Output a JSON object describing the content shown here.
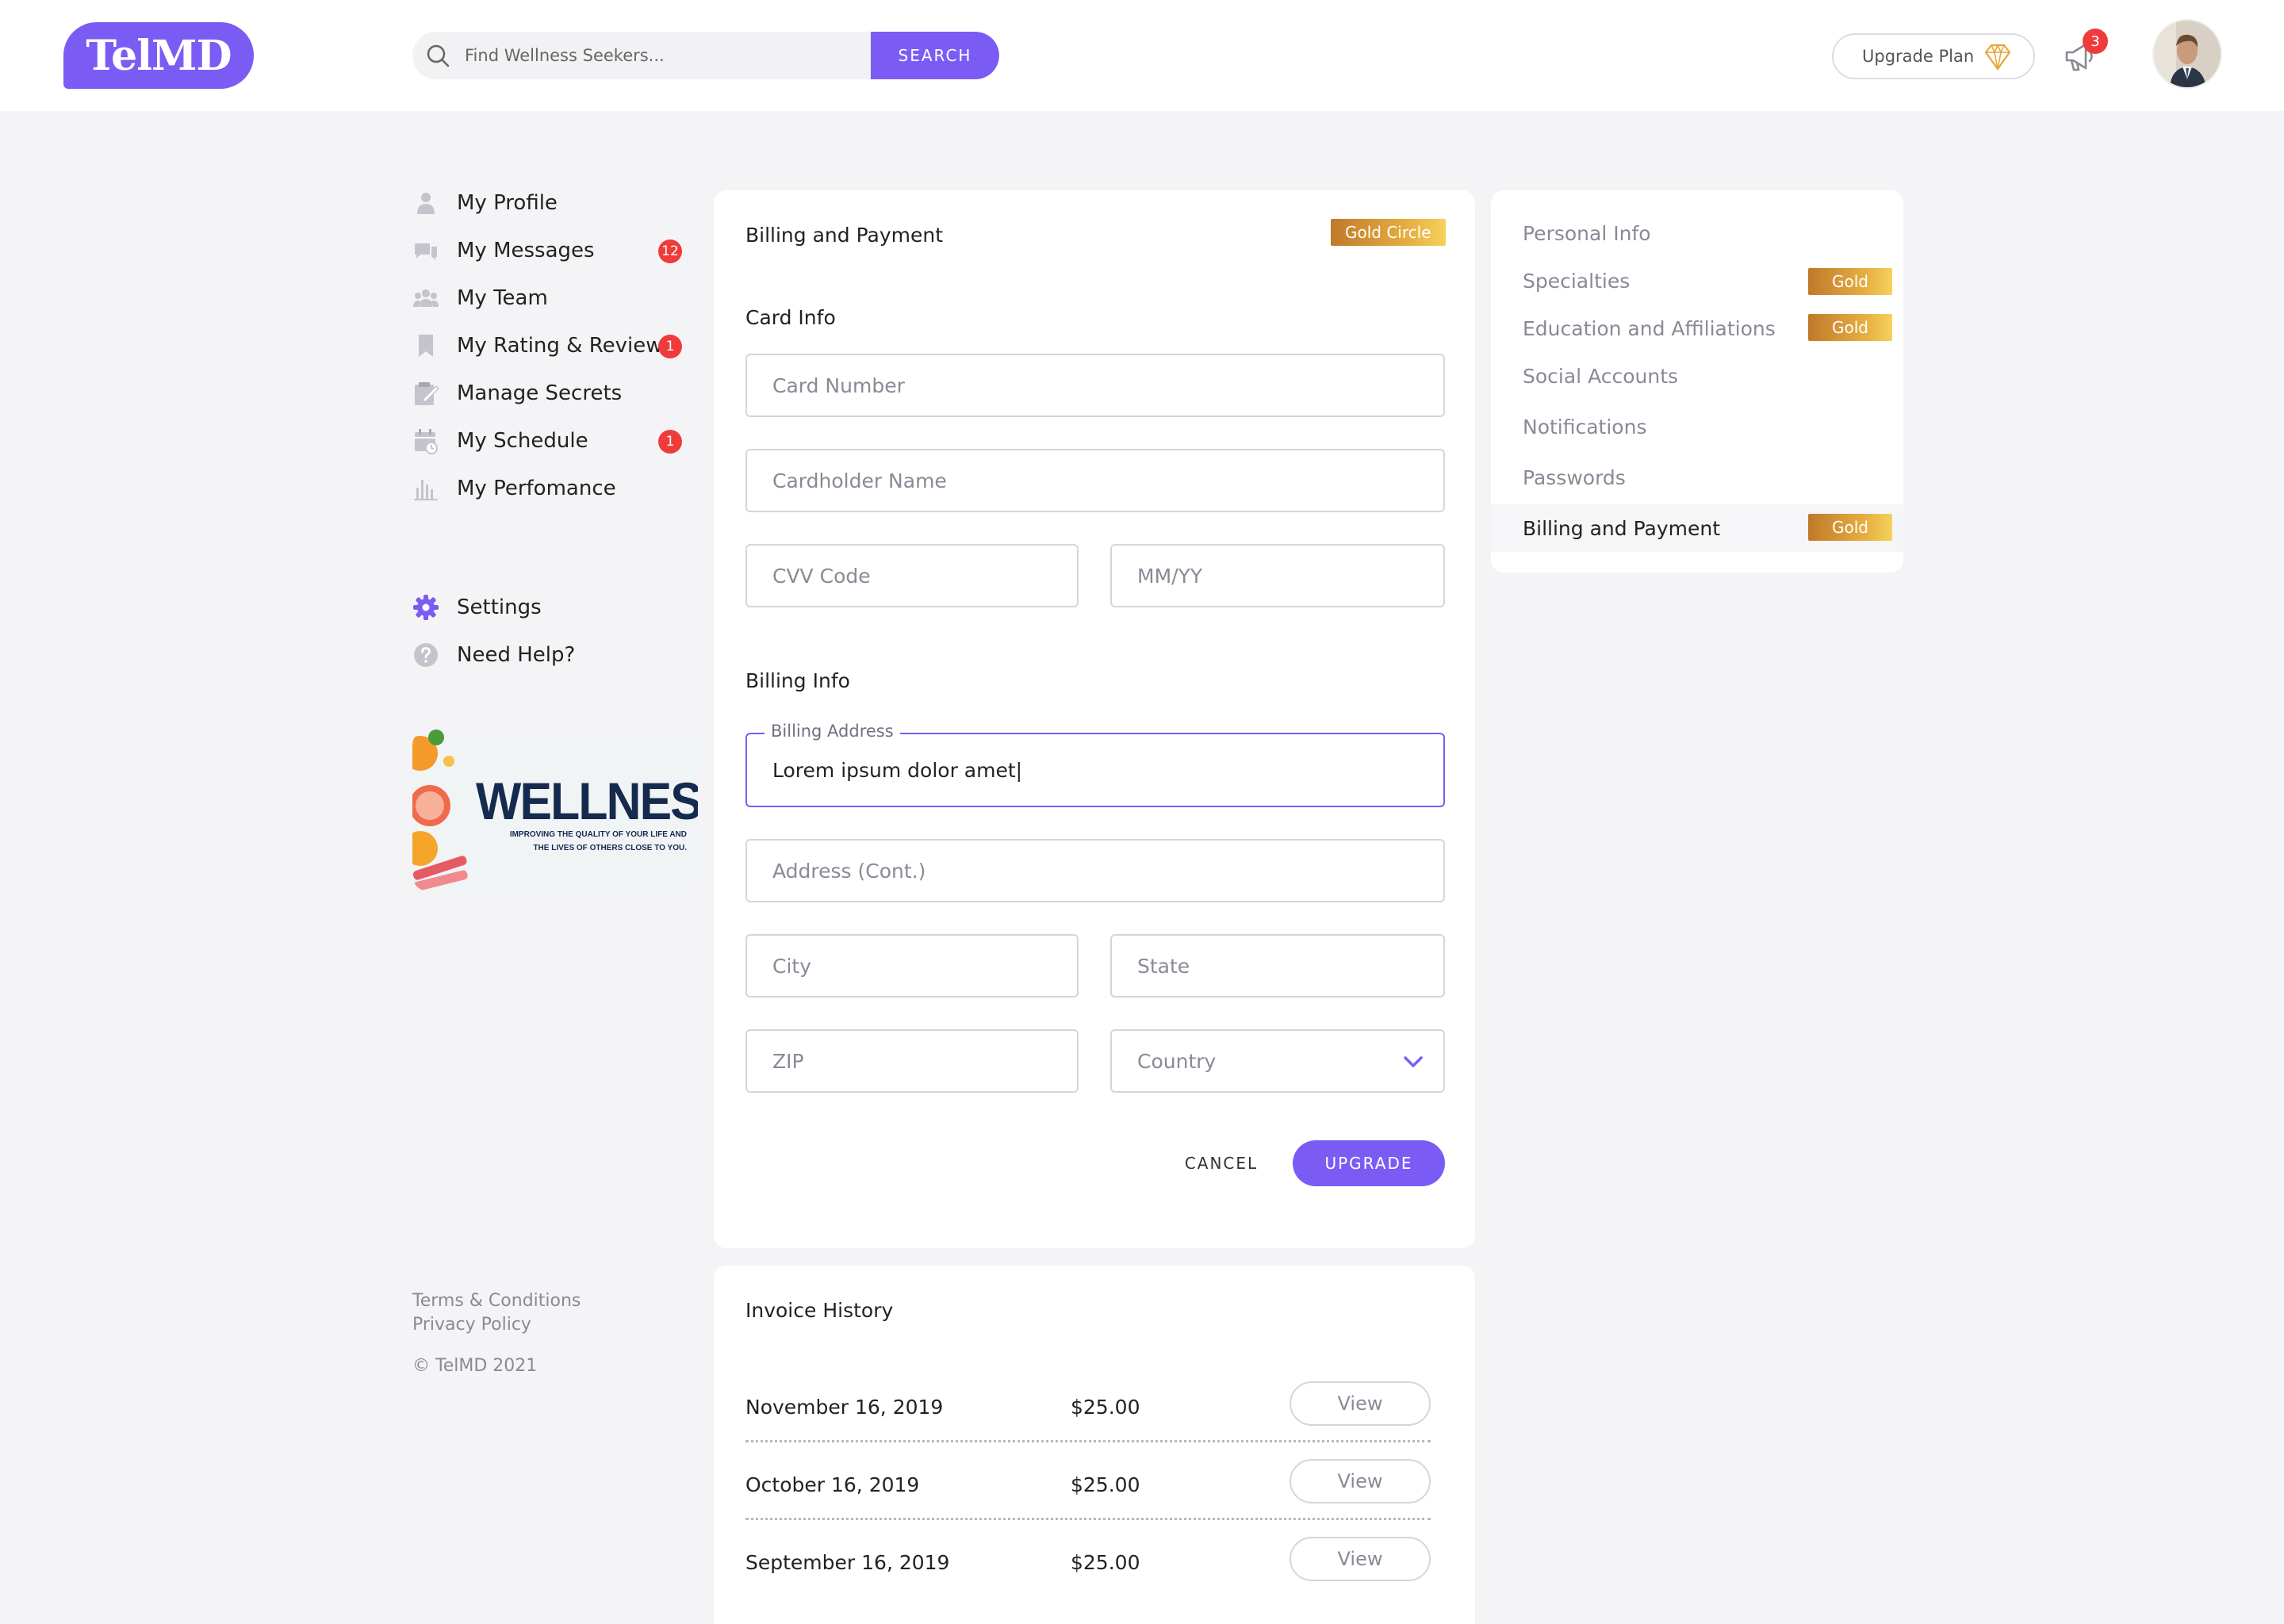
{
  "header": {
    "logo": "TelMD",
    "search_placeholder": "Find Wellness Seekers...",
    "search_button": "SEARCH",
    "upgrade_plan": "Upgrade Plan",
    "notification_count": "3"
  },
  "sidebar": {
    "items": [
      {
        "label": "My Profile",
        "icon": "user-icon"
      },
      {
        "label": "My Messages",
        "icon": "chat-icon",
        "badge": "12"
      },
      {
        "label": "My Team",
        "icon": "team-icon"
      },
      {
        "label": "My Rating & Reviews",
        "icon": "bookmark-icon",
        "badge": "1"
      },
      {
        "label": "Manage Secrets",
        "icon": "edit-icon"
      },
      {
        "label": "My Schedule",
        "icon": "calendar-icon",
        "badge": "1"
      },
      {
        "label": "My Perfomance",
        "icon": "chart-icon"
      }
    ],
    "settings": "Settings",
    "help": "Need Help?",
    "promo_title": "WELLNESS",
    "promo_sub_1": "IMPROVING THE QUALITY OF YOUR LIFE AND",
    "promo_sub_2": "THE LIVES OF OTHERS CLOSE TO YOU.",
    "terms": "Terms & Conditions",
    "privacy": "Privacy Policy",
    "copyright": "© TelMD 2021"
  },
  "billing": {
    "title": "Billing and Payment",
    "tag": "Gold Circle",
    "card_info": "Card Info",
    "card_number": "Card Number",
    "cardholder": "Cardholder Name",
    "cvv": "CVV Code",
    "expiry": "MM/YY",
    "billing_info": "Billing Info",
    "address_label": "Billing Address",
    "address_value": "Lorem ipsum dolor amet|",
    "address_cont": "Address (Cont.)",
    "city": "City",
    "state": "State",
    "zip": "ZIP",
    "country": "Country",
    "cancel": "CANCEL",
    "upgrade": "UPGRADE"
  },
  "invoices": {
    "title": "Invoice History",
    "rows": [
      {
        "date": "November 16, 2019",
        "amount": "$25.00",
        "action": "View"
      },
      {
        "date": "October 16, 2019",
        "amount": "$25.00",
        "action": "View"
      },
      {
        "date": "September 16, 2019",
        "amount": "$25.00",
        "action": "View"
      }
    ]
  },
  "settings_menu": {
    "items": [
      {
        "label": "Personal Info"
      },
      {
        "label": "Specialties",
        "tag": "Gold"
      },
      {
        "label": "Education and Affiliations",
        "tag": "Gold"
      },
      {
        "label": "Social Accounts"
      },
      {
        "label": "Notifications"
      },
      {
        "label": "Passwords"
      },
      {
        "label": "Billing and Payment",
        "tag": "Gold",
        "active": true
      }
    ]
  },
  "colors": {
    "accent": "#7a5cf5",
    "badge": "#ef3b3b",
    "gold": "#e7b142"
  }
}
